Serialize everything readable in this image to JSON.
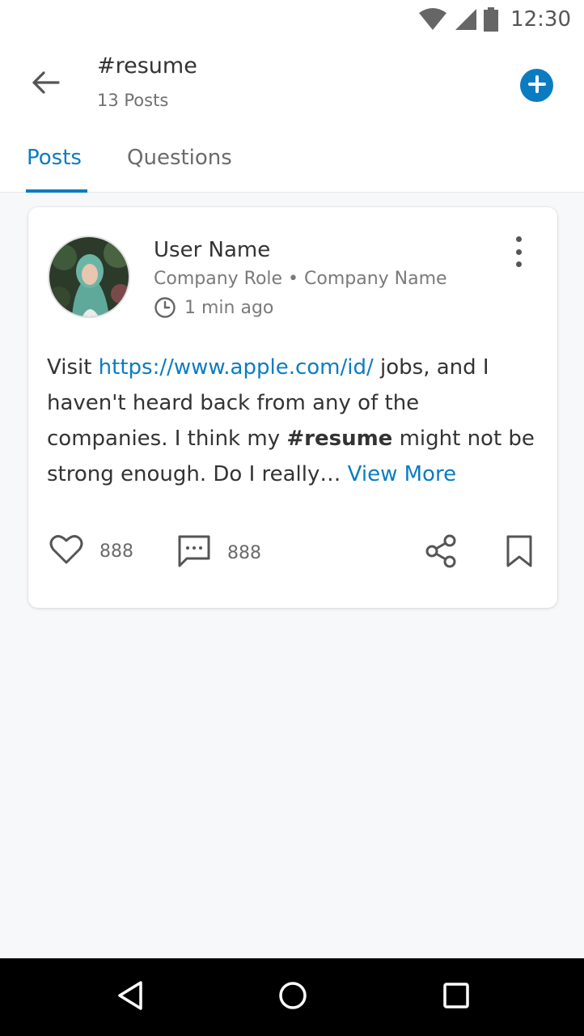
{
  "status_bar": {
    "time": "12:30",
    "icons": [
      "wifi-icon",
      "signal-icon",
      "battery-icon"
    ]
  },
  "header": {
    "title": "#resume",
    "subtitle": "13 Posts",
    "back_icon": "arrow-left-icon",
    "add_icon": "plus-circle-icon"
  },
  "tabs": [
    {
      "label": "Posts",
      "active": true
    },
    {
      "label": "Questions",
      "active": false
    }
  ],
  "post": {
    "user_name": "User Name",
    "company_line": "Company Role • Company Name",
    "time_ago": "1 min ago",
    "body": {
      "part1": "Visit ",
      "link": "https://www.apple.com/id/",
      "part2": " jobs, and I haven't heard back from any of the companies. I think my ",
      "hashtag": "#resume",
      "part3": " might not be strong enough. Do I really… ",
      "view_more": "View More"
    },
    "likes": "888",
    "comments": "888"
  },
  "colors": {
    "accent": "#0b7cc1",
    "background": "#f7f8fa",
    "card": "#ffffff"
  }
}
